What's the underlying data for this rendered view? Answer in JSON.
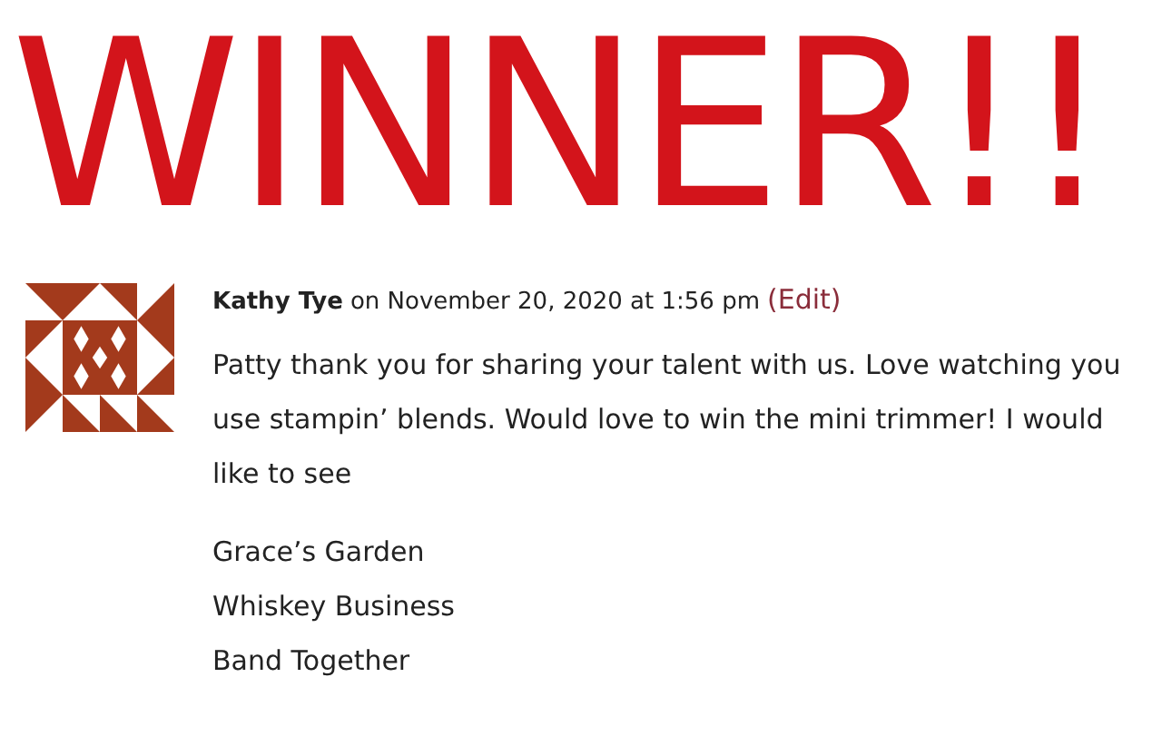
{
  "heading": "WINNER!!",
  "comment": {
    "author": "Kathy Tye",
    "date": "on November 20, 2020 at 1:56 pm",
    "edit_link": "(Edit)",
    "paragraphs": [
      "Patty thank you for sharing your talent with us. Love watching you use stampin’ blends. Would love to win the mini trimmer! I would like to see"
    ],
    "list": [
      "Grace’s Garden",
      "Whiskey Business",
      "Band Together"
    ]
  }
}
